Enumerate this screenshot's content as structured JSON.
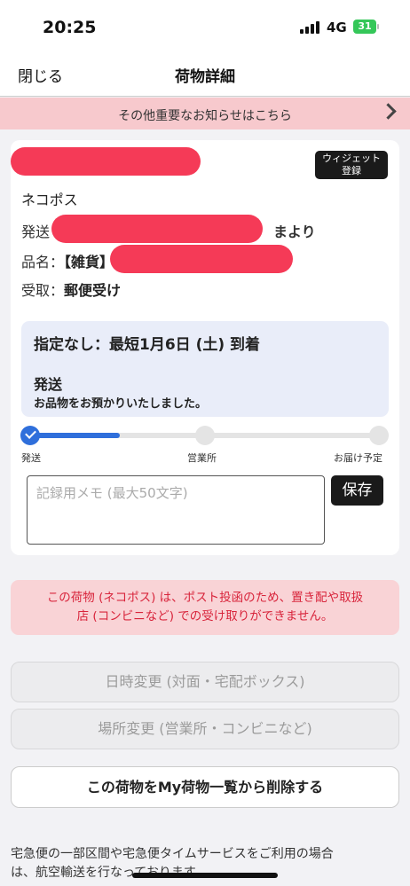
{
  "status_bar": {
    "time": "20:25",
    "network": "4G",
    "battery": "31"
  },
  "nav": {
    "close_label": "閉じる",
    "title": "荷物詳細"
  },
  "notice": {
    "text": "その他重要なお知らせはこちら"
  },
  "package": {
    "widget_button": "ウィジェット\n登録",
    "service": "ネコポス",
    "sender_label": "発送",
    "sender_suffix": "まより",
    "item_label": "品名：",
    "item_value": "【雑貨】",
    "receipt_label": "受取：",
    "receipt_value": "郵便受け"
  },
  "status": {
    "eta": "指定なし：最短1月6日 (土) 到着",
    "title": "発送",
    "description": "お品物をお預かりいたしました。"
  },
  "progress": {
    "fraction": 0.25,
    "stages": [
      "発送",
      "営業所",
      "お届け予定"
    ]
  },
  "memo": {
    "placeholder": "記録用メモ (最大50文字)",
    "save_label": "保存"
  },
  "warning": {
    "line1": "この荷物 (ネコポス) は、ポスト投函のため、置き配や取扱",
    "line2": "店 (コンビニなど) での受け取りができません。"
  },
  "actions": {
    "change_time": "日時変更 (対面・宅配ボックス)",
    "change_place": "場所変更 (営業所・コンビニなど)",
    "delete": "この荷物をMy荷物一覧から削除する"
  },
  "footer": {
    "line1": "宅急便の一部区間や宅急便タイムサービスをご利用の場合",
    "line2": "は、航空輸送を行なっております。"
  },
  "colors": {
    "accent": "#2f6fdb",
    "notice_bg": "#f7c9cd",
    "warning_text": "#d8243b",
    "redaction": "#f53a57"
  }
}
